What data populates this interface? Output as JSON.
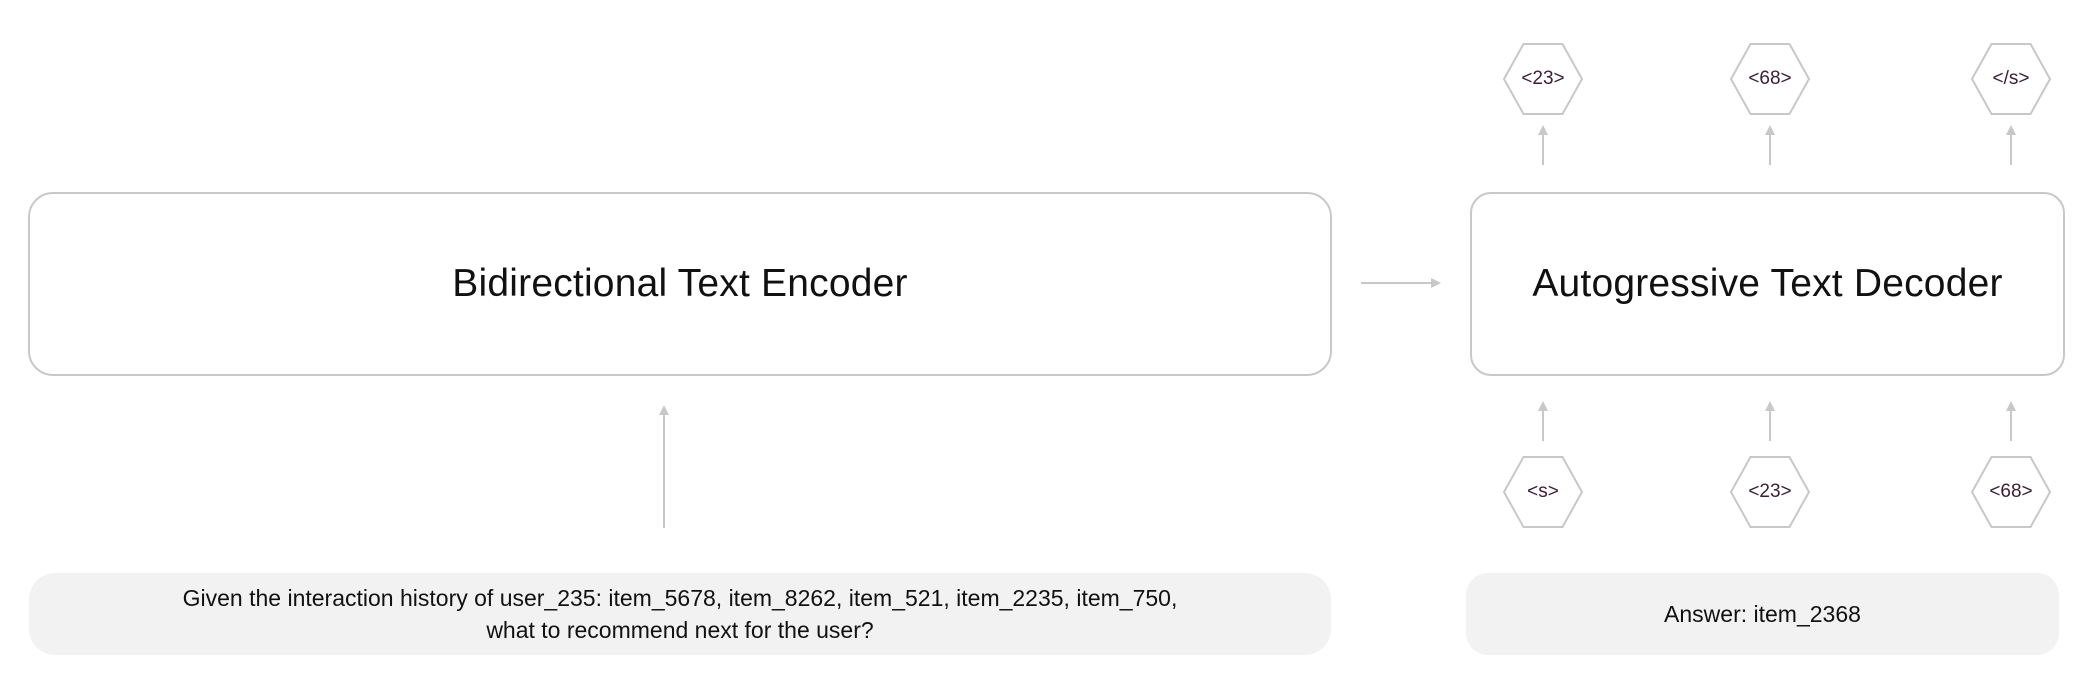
{
  "encoder": {
    "title": "Bidirectional Text Encoder",
    "input_line1": "Given the interaction history of user_235: item_5678, item_8262, item_521, item_2235, item_750,",
    "input_line2": "what to recommend next for the user?"
  },
  "decoder": {
    "title": "Autogressive Text Decoder",
    "answer": "Answer: item_2368",
    "input_tokens": [
      "<s>",
      "<23>",
      "<68>"
    ],
    "output_tokens": [
      "<23>",
      "<68>",
      "</s>"
    ]
  },
  "colors": {
    "border": "#c8c8c8",
    "pill_fill": "#f2f2f2",
    "arrow": "#c8c8c8",
    "token_text": "#3b1f33"
  }
}
